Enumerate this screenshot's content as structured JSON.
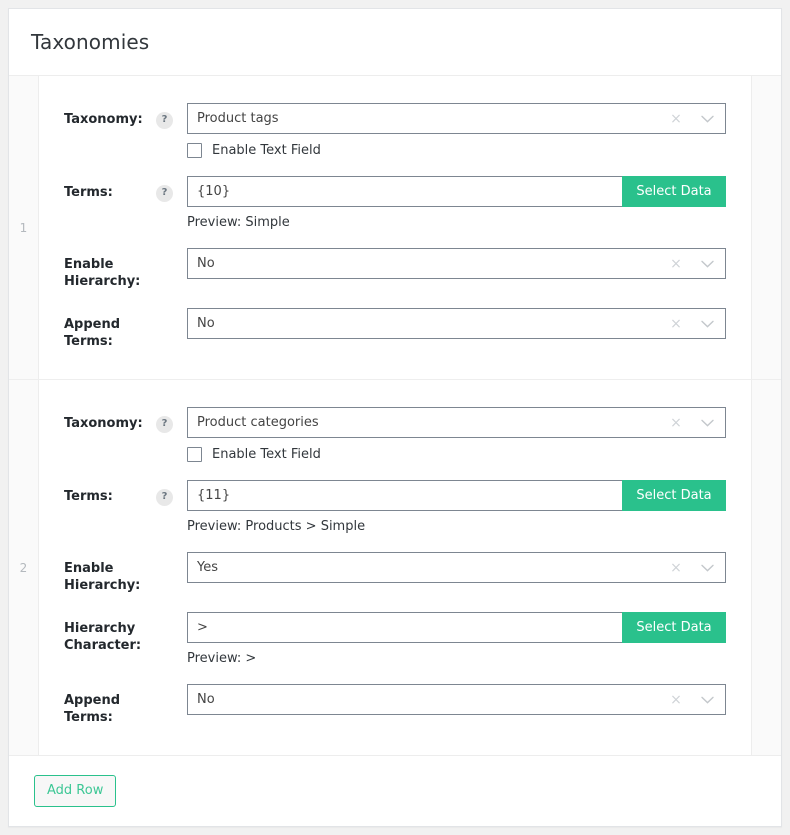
{
  "panel": {
    "title": "Taxonomies"
  },
  "labels": {
    "taxonomy": "Taxonomy:",
    "terms": "Terms:",
    "enable_hierarchy": "Enable Hierarchy:",
    "hierarchy_character": "Hierarchy Character:",
    "append_terms": "Append Terms:",
    "enable_text_field": "Enable Text Field",
    "help": "?",
    "select_data": "Select Data",
    "clear": "×"
  },
  "footer": {
    "add_row": "Add Row"
  },
  "colors": {
    "accent_green": "#2ac18c",
    "add_row_text": "#3cc795",
    "field_border": "#7d8691",
    "row_index_text": "#b4b9be"
  },
  "rows": [
    {
      "index": "1",
      "taxonomy": {
        "value": "Product tags",
        "text_field_checked": false
      },
      "terms": {
        "value": "{10}",
        "preview": "Preview: Simple"
      },
      "enable_hierarchy": {
        "value": "No"
      },
      "hierarchy_character": null,
      "append_terms": {
        "value": "No"
      }
    },
    {
      "index": "2",
      "taxonomy": {
        "value": "Product categories",
        "text_field_checked": false
      },
      "terms": {
        "value": "{11}",
        "preview": "Preview: Products > Simple"
      },
      "enable_hierarchy": {
        "value": "Yes"
      },
      "hierarchy_character": {
        "value": ">",
        "preview": "Preview: >"
      },
      "append_terms": {
        "value": "No"
      }
    }
  ]
}
